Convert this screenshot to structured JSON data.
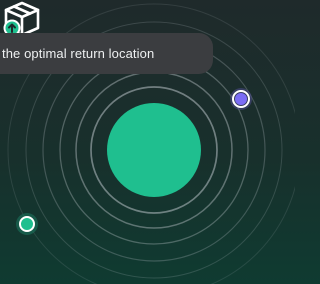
{
  "banner": {
    "text": "the optimal return location"
  },
  "hub": {
    "icon": "box-return-icon",
    "color": "#1fbf8f"
  },
  "markers": {
    "purple": {
      "color": "#7b6cf6"
    },
    "green": {
      "color": "#1fbf8f"
    }
  },
  "colors": {
    "ring": "#b8c1c6",
    "background": "#1c2a2b"
  }
}
